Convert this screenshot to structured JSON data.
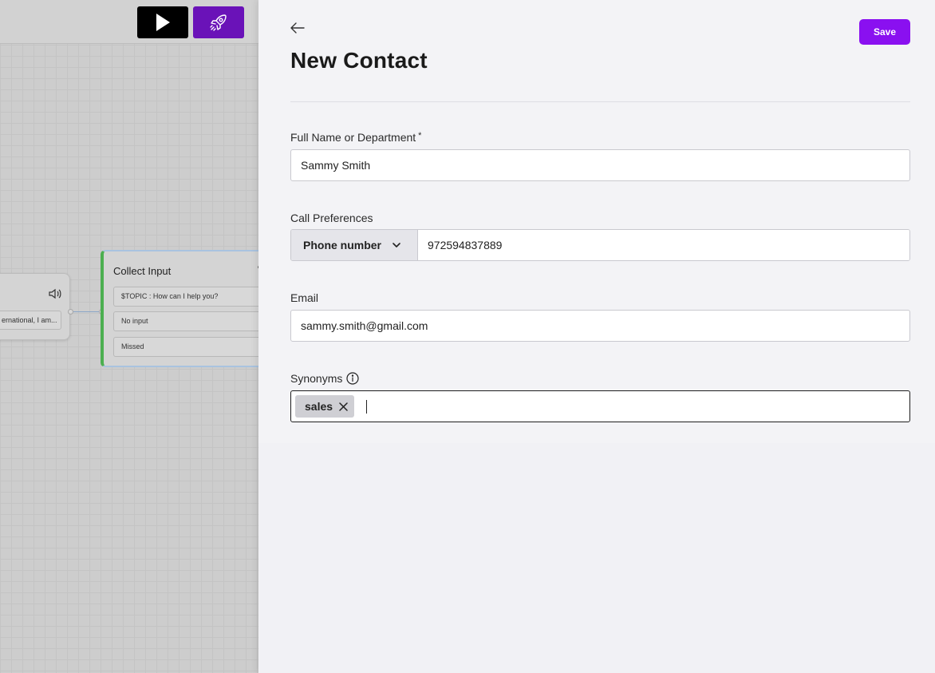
{
  "canvas": {
    "left_node": {
      "chip_text": "ernational, I am..."
    },
    "collect_node": {
      "title": "Collect Input",
      "rows": [
        "$TOPIC : How can I help you?",
        "No input",
        "Missed"
      ]
    }
  },
  "panel": {
    "title": "New Contact",
    "save_label": "Save",
    "fields": {
      "full_name": {
        "label": "Full Name or Department",
        "required_mark": "*",
        "value": "Sammy Smith"
      },
      "call_preferences": {
        "label": "Call Preferences",
        "type_label": "Phone number",
        "value": "972594837889"
      },
      "email": {
        "label": "Email",
        "value": "sammy.smith@gmail.com"
      },
      "synonyms": {
        "label": "Synonyms",
        "tags": [
          "sales"
        ],
        "input_value": ""
      }
    }
  },
  "colors": {
    "accent": "#8a10f0",
    "play_button": "#000000",
    "rocket_button": "#6a12b8",
    "node_stripe": "#4caf50"
  },
  "icons": [
    "play-icon",
    "rocket-icon",
    "speaker-icon",
    "back-arrow-icon",
    "chevron-down-icon",
    "info-icon",
    "close-icon"
  ]
}
